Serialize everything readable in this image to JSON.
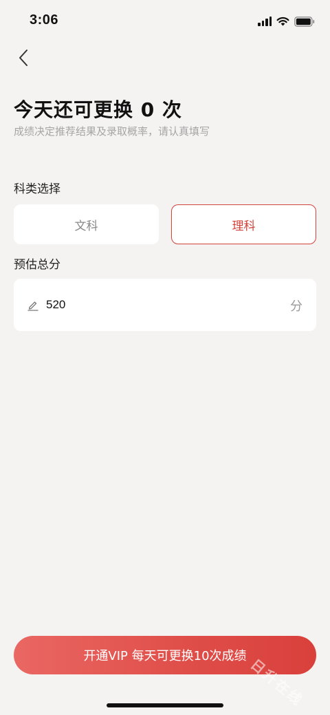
{
  "status_bar": {
    "time": "3:06",
    "icons": [
      "cellular-signal-icon",
      "wifi-icon",
      "battery-icon"
    ]
  },
  "nav": {
    "back_icon": "chevron-left-icon"
  },
  "header": {
    "title": "今天还可更换 0 次",
    "subtitle": "成绩决定推荐结果及录取概率，请认真填写"
  },
  "subject": {
    "label": "科类选择",
    "options": [
      {
        "label": "文科",
        "selected": false
      },
      {
        "label": "理科",
        "selected": true
      }
    ]
  },
  "score": {
    "label": "预估总分",
    "value": "520",
    "unit": "分",
    "icon": "pencil-icon"
  },
  "cta": {
    "label": "开通VIP 每天可更换10次成绩"
  },
  "watermark": {
    "text": "日升在线"
  },
  "colors": {
    "accent": "#d2413a",
    "background": "#f5f3f2",
    "card": "#ffffff"
  }
}
